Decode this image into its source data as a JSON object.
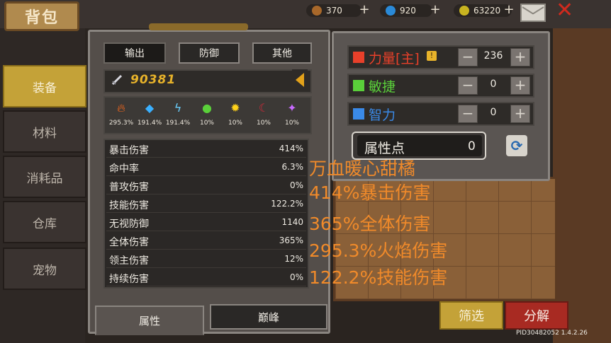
{
  "window": {
    "title": "背包"
  },
  "currencies": [
    {
      "icon": "wood-icon",
      "value": "370",
      "color": "#a8682a"
    },
    {
      "icon": "gem-icon",
      "value": "920",
      "color": "#2a8ad8"
    },
    {
      "icon": "gold-coin-icon",
      "value": "63220",
      "color": "#c8b420"
    }
  ],
  "side_tabs": [
    "装备",
    "材料",
    "消耗品",
    "仓库",
    "宠物"
  ],
  "panel_tabs": [
    "输出",
    "防御",
    "其他"
  ],
  "power": "90381",
  "elements": [
    {
      "icon": "fire-icon",
      "value": "295.3%",
      "color": "#ff6a1a"
    },
    {
      "icon": "ice-crystal-icon",
      "value": "191.4%",
      "color": "#3ab0ff"
    },
    {
      "icon": "lightning-icon",
      "value": "191.4%",
      "color": "#6ad0ff"
    },
    {
      "icon": "poison-skull-icon",
      "value": "10%",
      "color": "#5ad03a"
    },
    {
      "icon": "sun-icon",
      "value": "10%",
      "color": "#ffd21a"
    },
    {
      "icon": "dark-moon-icon",
      "value": "10%",
      "color": "#d02a3a"
    },
    {
      "icon": "arcane-icon",
      "value": "10%",
      "color": "#c86aff"
    }
  ],
  "stats": [
    {
      "label": "暴击伤害",
      "value": "414%"
    },
    {
      "label": "命中率",
      "value": "6.3%"
    },
    {
      "label": "普攻伤害",
      "value": "0%"
    },
    {
      "label": "技能伤害",
      "value": "122.2%"
    },
    {
      "label": "无视防御",
      "value": "1140"
    },
    {
      "label": "全体伤害",
      "value": "365%"
    },
    {
      "label": "领主伤害",
      "value": "12%"
    },
    {
      "label": "持续伤害",
      "value": "0%"
    }
  ],
  "bottom_tabs": [
    "属性",
    "巅峰"
  ],
  "attributes": [
    {
      "name": "力量[主]",
      "value": "236",
      "color": "#e8402a",
      "badge": "!"
    },
    {
      "name": "敏捷",
      "value": "0",
      "color": "#5ad03a",
      "badge": ""
    },
    {
      "name": "智力",
      "value": "0",
      "color": "#3a8ae8",
      "badge": ""
    }
  ],
  "points": {
    "label": "属性点",
    "value": "0"
  },
  "overlay_lines": [
    "万血暖心甜橘",
    "414%暴击伤害",
    "365%全体伤害",
    "295.3%火焰伤害",
    "122.2%技能伤害"
  ],
  "buttons": {
    "filter": "筛选",
    "decompose": "分解"
  },
  "pid": "PID30482052 1.4.2.26"
}
